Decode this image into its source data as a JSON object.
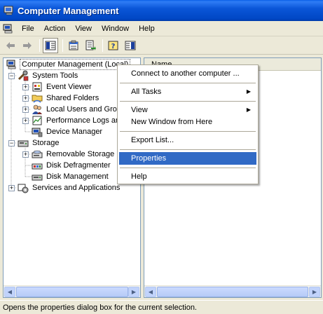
{
  "window": {
    "title": "Computer Management"
  },
  "menubar": {
    "items": [
      "File",
      "Action",
      "View",
      "Window",
      "Help"
    ]
  },
  "toolbar": {
    "buttons": [
      "back-arrow-icon",
      "forward-arrow-icon",
      "show-hide-tree-icon",
      "properties-icon",
      "export-list-icon",
      "help-icon",
      "show-hide-action-pane-icon"
    ]
  },
  "tree": {
    "root": "Computer Management (Local)",
    "system_tools": "System Tools",
    "event_viewer": "Event Viewer",
    "shared_folders": "Shared Folders",
    "local_users": "Local Users and Groups",
    "performance": "Performance Logs and Alerts",
    "device_manager": "Device Manager",
    "storage": "Storage",
    "removable_storage": "Removable Storage",
    "disk_defragmenter": "Disk Defragmenter",
    "disk_management": "Disk Management",
    "services": "Services and Applications"
  },
  "list": {
    "column_name": "Name"
  },
  "context_menu": {
    "connect": "Connect to another computer ...",
    "all_tasks": "All Tasks",
    "view": "View",
    "new_window": "New Window from Here",
    "export_list": "Export List...",
    "properties": "Properties",
    "help": "Help"
  },
  "status": {
    "text": "Opens the properties dialog box for the current selection."
  },
  "colors": {
    "title_blue": "#0a56d8",
    "highlight": "#316ac5",
    "face": "#ece9d8"
  }
}
